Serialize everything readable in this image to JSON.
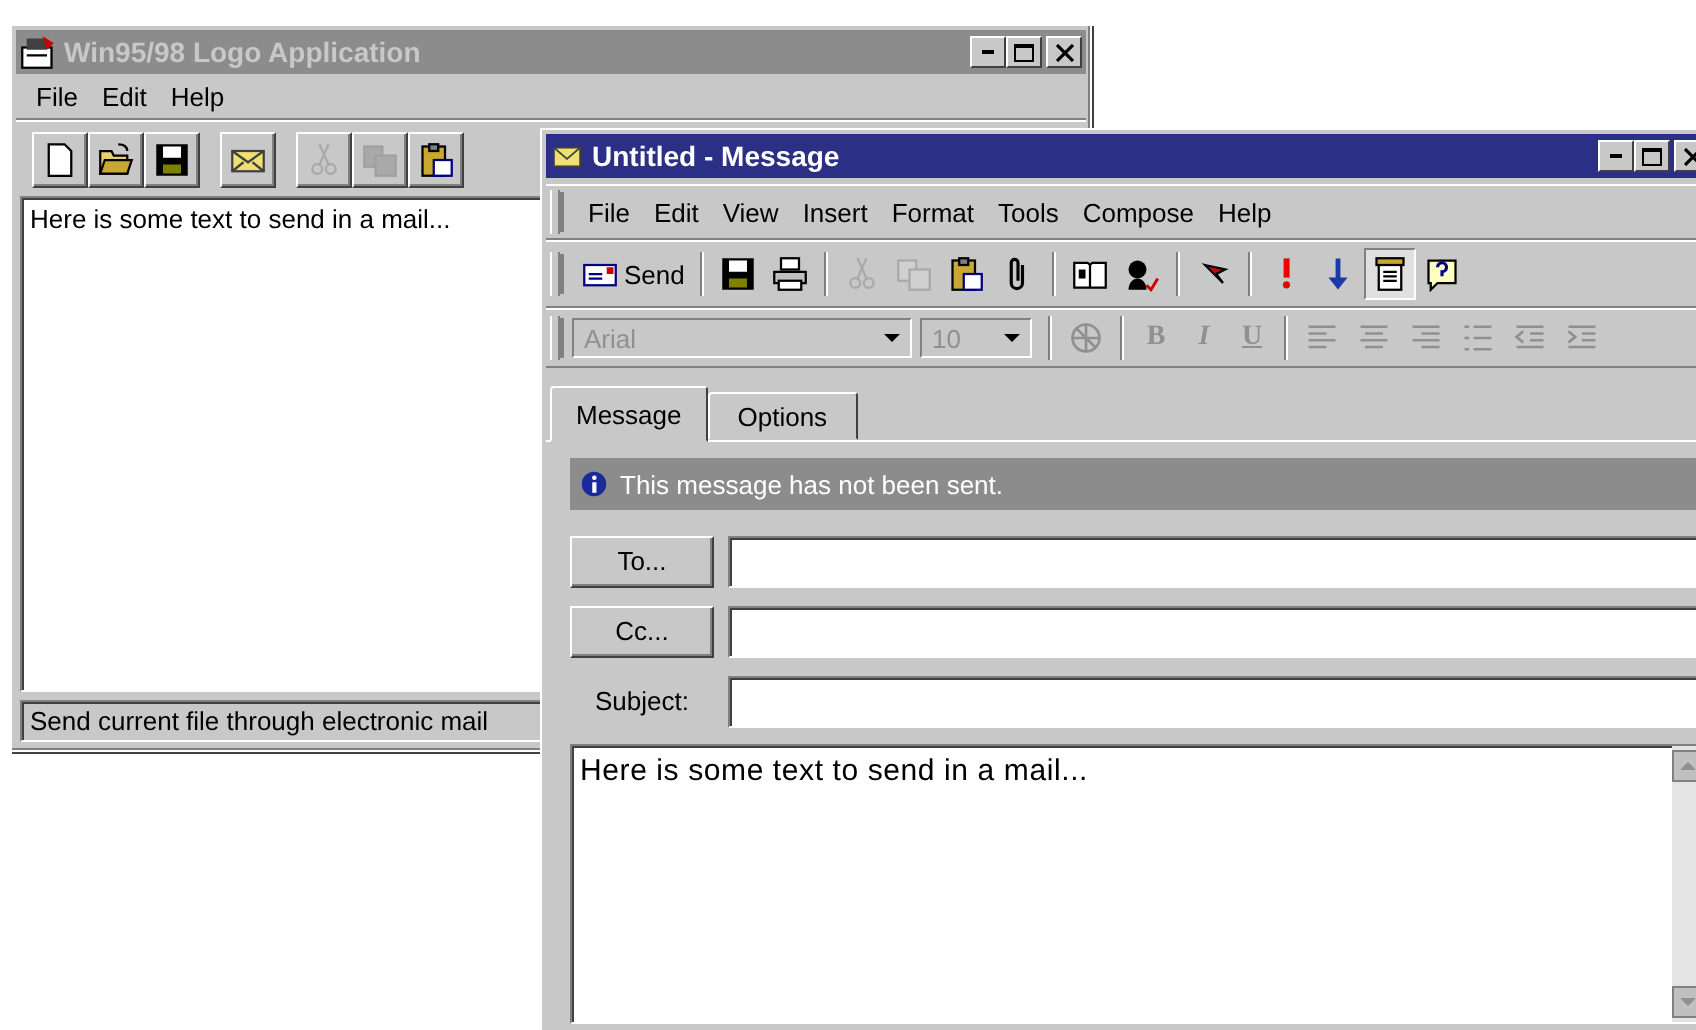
{
  "back_window": {
    "title": "Win95/98 Logo Application",
    "active": false,
    "menu": [
      "File",
      "Edit",
      "Help"
    ],
    "toolbar": [
      [
        {
          "kind": "new",
          "disabled": false
        },
        {
          "kind": "open",
          "disabled": false
        },
        {
          "kind": "save",
          "disabled": false
        }
      ],
      [
        {
          "kind": "mail",
          "disabled": false
        }
      ],
      [
        {
          "kind": "cut",
          "disabled": true
        },
        {
          "kind": "copy",
          "disabled": true
        },
        {
          "kind": "paste",
          "disabled": false
        }
      ]
    ],
    "document_text": "Here is some text to send in a mail...",
    "status_bar": "Send current file through electronic mail"
  },
  "front_window": {
    "title": "Untitled - Message",
    "active": true,
    "menu": [
      "File",
      "Edit",
      "View",
      "Insert",
      "Format",
      "Tools",
      "Compose",
      "Help"
    ],
    "toolbar": [
      [
        {
          "kind": "send",
          "label": "Send",
          "disabled": false,
          "pressed": false
        }
      ],
      [
        {
          "kind": "save",
          "disabled": false,
          "pressed": false
        },
        {
          "kind": "print",
          "disabled": false,
          "pressed": false
        }
      ],
      [
        {
          "kind": "cut",
          "disabled": true,
          "pressed": false
        },
        {
          "kind": "copy",
          "disabled": true,
          "pressed": false
        },
        {
          "kind": "paste",
          "disabled": false,
          "pressed": false
        },
        {
          "kind": "attach",
          "disabled": false,
          "pressed": false
        }
      ],
      [
        {
          "kind": "addressbook",
          "disabled": false,
          "pressed": false
        },
        {
          "kind": "spellcheck",
          "disabled": false,
          "pressed": false
        }
      ],
      [
        {
          "kind": "flag",
          "disabled": false,
          "pressed": false
        }
      ],
      [
        {
          "kind": "high",
          "disabled": false,
          "pressed": false
        },
        {
          "kind": "low",
          "disabled": false,
          "pressed": false
        },
        {
          "kind": "properties",
          "disabled": false,
          "pressed": true
        },
        {
          "kind": "help",
          "disabled": false,
          "pressed": false
        }
      ]
    ],
    "format_bar": {
      "font": "Arial",
      "size": "10",
      "disabled": true,
      "groups": [
        [
          {
            "kind": "stationery"
          }
        ],
        [
          {
            "kind": "letter",
            "label": "B"
          },
          {
            "kind": "letter",
            "label": "I"
          },
          {
            "kind": "letter",
            "label": "U"
          }
        ],
        [
          {
            "kind": "align-left"
          },
          {
            "kind": "align-center"
          },
          {
            "kind": "align-right"
          },
          {
            "kind": "bullets"
          },
          {
            "kind": "outdent"
          },
          {
            "kind": "indent"
          }
        ]
      ]
    },
    "tabs": [
      {
        "label": "Message",
        "selected": true
      },
      {
        "label": "Options",
        "selected": false
      }
    ],
    "info": "This message has not been sent.",
    "fields": [
      {
        "kind": "button",
        "label": "To..."
      },
      {
        "kind": "button",
        "label": "Cc..."
      },
      {
        "kind": "label",
        "label": "Subject:"
      }
    ],
    "body": "Here is some text to send in a mail..."
  }
}
